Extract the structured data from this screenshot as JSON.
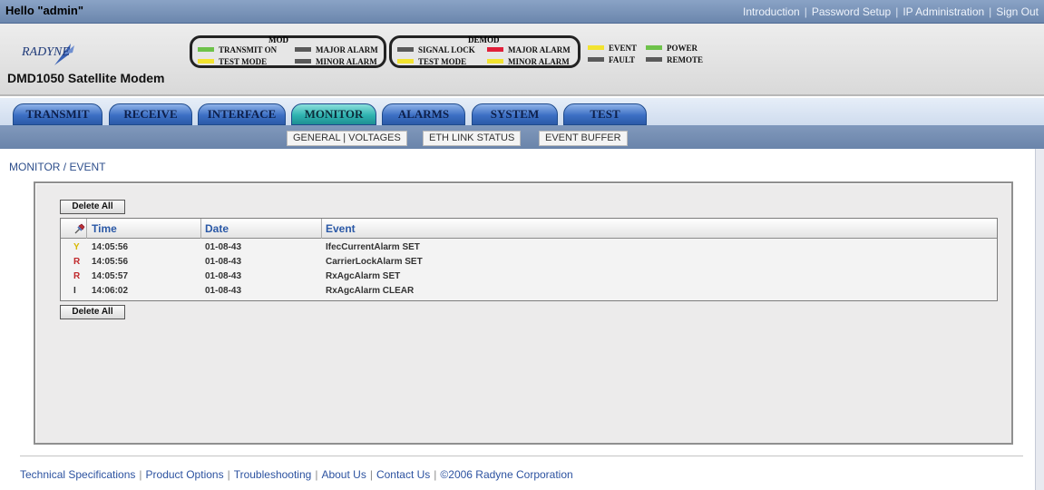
{
  "topbar": {
    "greeting": "Hello \"admin\"",
    "links": [
      "Introduction",
      "Password Setup",
      "IP Administration",
      "Sign Out"
    ]
  },
  "header": {
    "logo_text": "RADYNE",
    "model": "DMD1050 Satellite Modem",
    "mod_title": "MOD",
    "demod_title": "DEMOD",
    "indicators": {
      "transmit_on": {
        "label": "TRANSMIT ON",
        "color": "#6ec24a"
      },
      "mod_major_alarm": {
        "label": "MAJOR ALARM",
        "color": "#5a5a5a"
      },
      "mod_test_mode": {
        "label": "TEST MODE",
        "color": "#f2e330"
      },
      "mod_minor_alarm": {
        "label": "MINOR ALARM",
        "color": "#5a5a5a"
      },
      "signal_lock": {
        "label": "SIGNAL LOCK",
        "color": "#5a5a5a"
      },
      "demod_major_alarm": {
        "label": "MAJOR ALARM",
        "color": "#e0203a"
      },
      "demod_test_mode": {
        "label": "TEST MODE",
        "color": "#f2e330"
      },
      "demod_minor_alarm": {
        "label": "MINOR ALARM",
        "color": "#f2e330"
      },
      "event": {
        "label": "EVENT",
        "color": "#f2e330"
      },
      "power": {
        "label": "POWER",
        "color": "#6ec24a"
      },
      "fault": {
        "label": "FAULT",
        "color": "#5a5a5a"
      },
      "remote": {
        "label": "REMOTE",
        "color": "#5a5a5a"
      }
    }
  },
  "tabs": [
    {
      "label": "TRANSMIT",
      "active": false
    },
    {
      "label": "RECEIVE",
      "active": false
    },
    {
      "label": "INTERFACE",
      "active": false
    },
    {
      "label": "MONITOR",
      "active": true
    },
    {
      "label": "ALARMS",
      "active": false
    },
    {
      "label": "SYSTEM",
      "active": false
    },
    {
      "label": "TEST",
      "active": false
    }
  ],
  "subnav": [
    "GENERAL | VOLTAGES",
    "ETH LINK STATUS",
    "EVENT BUFFER"
  ],
  "main": {
    "breadcrumb": "MONITOR / EVENT",
    "delete_all_label": "Delete All",
    "columns": {
      "time": "Time",
      "date": "Date",
      "event": "Event"
    },
    "events": [
      {
        "severity": "Y",
        "time": "14:05:56",
        "date": "01-08-43",
        "event": "IfecCurrentAlarm SET"
      },
      {
        "severity": "R",
        "time": "14:05:56",
        "date": "01-08-43",
        "event": "CarrierLockAlarm SET"
      },
      {
        "severity": "R",
        "time": "14:05:57",
        "date": "01-08-43",
        "event": "RxAgcAlarm SET"
      },
      {
        "severity": "I",
        "time": "14:06:02",
        "date": "01-08-43",
        "event": "RxAgcAlarm CLEAR"
      }
    ]
  },
  "footer": {
    "links": [
      "Technical Specifications",
      "Product Options",
      "Troubleshooting",
      "About Us",
      "Contact Us",
      "©2006 Radyne Corporation"
    ]
  }
}
